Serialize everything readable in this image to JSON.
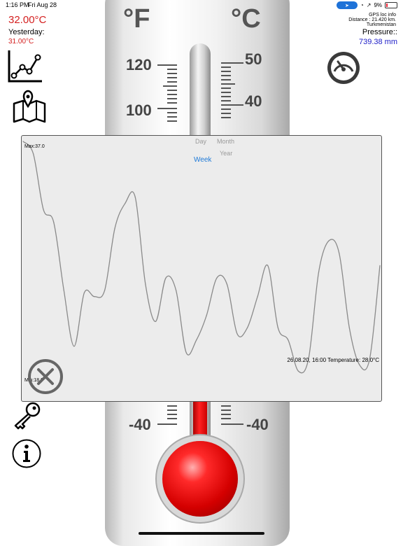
{
  "status_bar": {
    "time": "1:16 PM",
    "date": "Fri Aug 28",
    "battery": "9%",
    "location_pill_color": "#1e72d8"
  },
  "thermometer": {
    "unit_f": "°F",
    "unit_c": "°C",
    "f_labels": [
      "120",
      "100",
      "-40"
    ],
    "c_labels": [
      "50",
      "40",
      "-40"
    ]
  },
  "current": {
    "temperature": "32.00°C",
    "yesterday_label": "Yesterday:",
    "yesterday_value": "31.00°C",
    "accent_color": "#d42020"
  },
  "gps": {
    "title": "GPS loc info",
    "distance": "Distance : 21.420 km.",
    "place": "Turkmenistan"
  },
  "pressure": {
    "label": "Pressure::",
    "value": "739.38 mm",
    "color": "#2020c8"
  },
  "chart_panel": {
    "segments": {
      "day": "Day",
      "month": "Month",
      "year": "Year",
      "week": "Week"
    },
    "selected_segment": "week",
    "max_label": "Max:37.0",
    "min_label": "Min:18.0",
    "readout": "26.08.20, 16:00 Temperature: 28.0°C"
  },
  "chart_data": {
    "type": "line",
    "ylim": [
      18,
      37
    ],
    "series": [
      {
        "values": [
          37.0,
          36.0,
          31.5,
          30.5,
          25.0,
          20.5,
          24.8,
          24.5,
          25.0,
          30.0,
          32.0,
          32.5,
          25.5,
          22.5,
          26.0,
          25.0,
          20.0,
          21.0,
          23.0,
          26.0,
          25.5,
          21.5,
          22.0,
          24.5,
          27.0,
          22.0,
          21.0,
          18.5,
          19.5,
          26.5,
          29.0,
          28.0,
          22.0,
          19.0,
          19.5,
          27.0
        ]
      }
    ]
  },
  "icons": {
    "chart": "line-chart-icon",
    "map": "map-pin-icon",
    "gauge": "pressure-gauge-icon",
    "key": "key-icon",
    "info": "info-icon",
    "close": "close-circle-icon"
  }
}
